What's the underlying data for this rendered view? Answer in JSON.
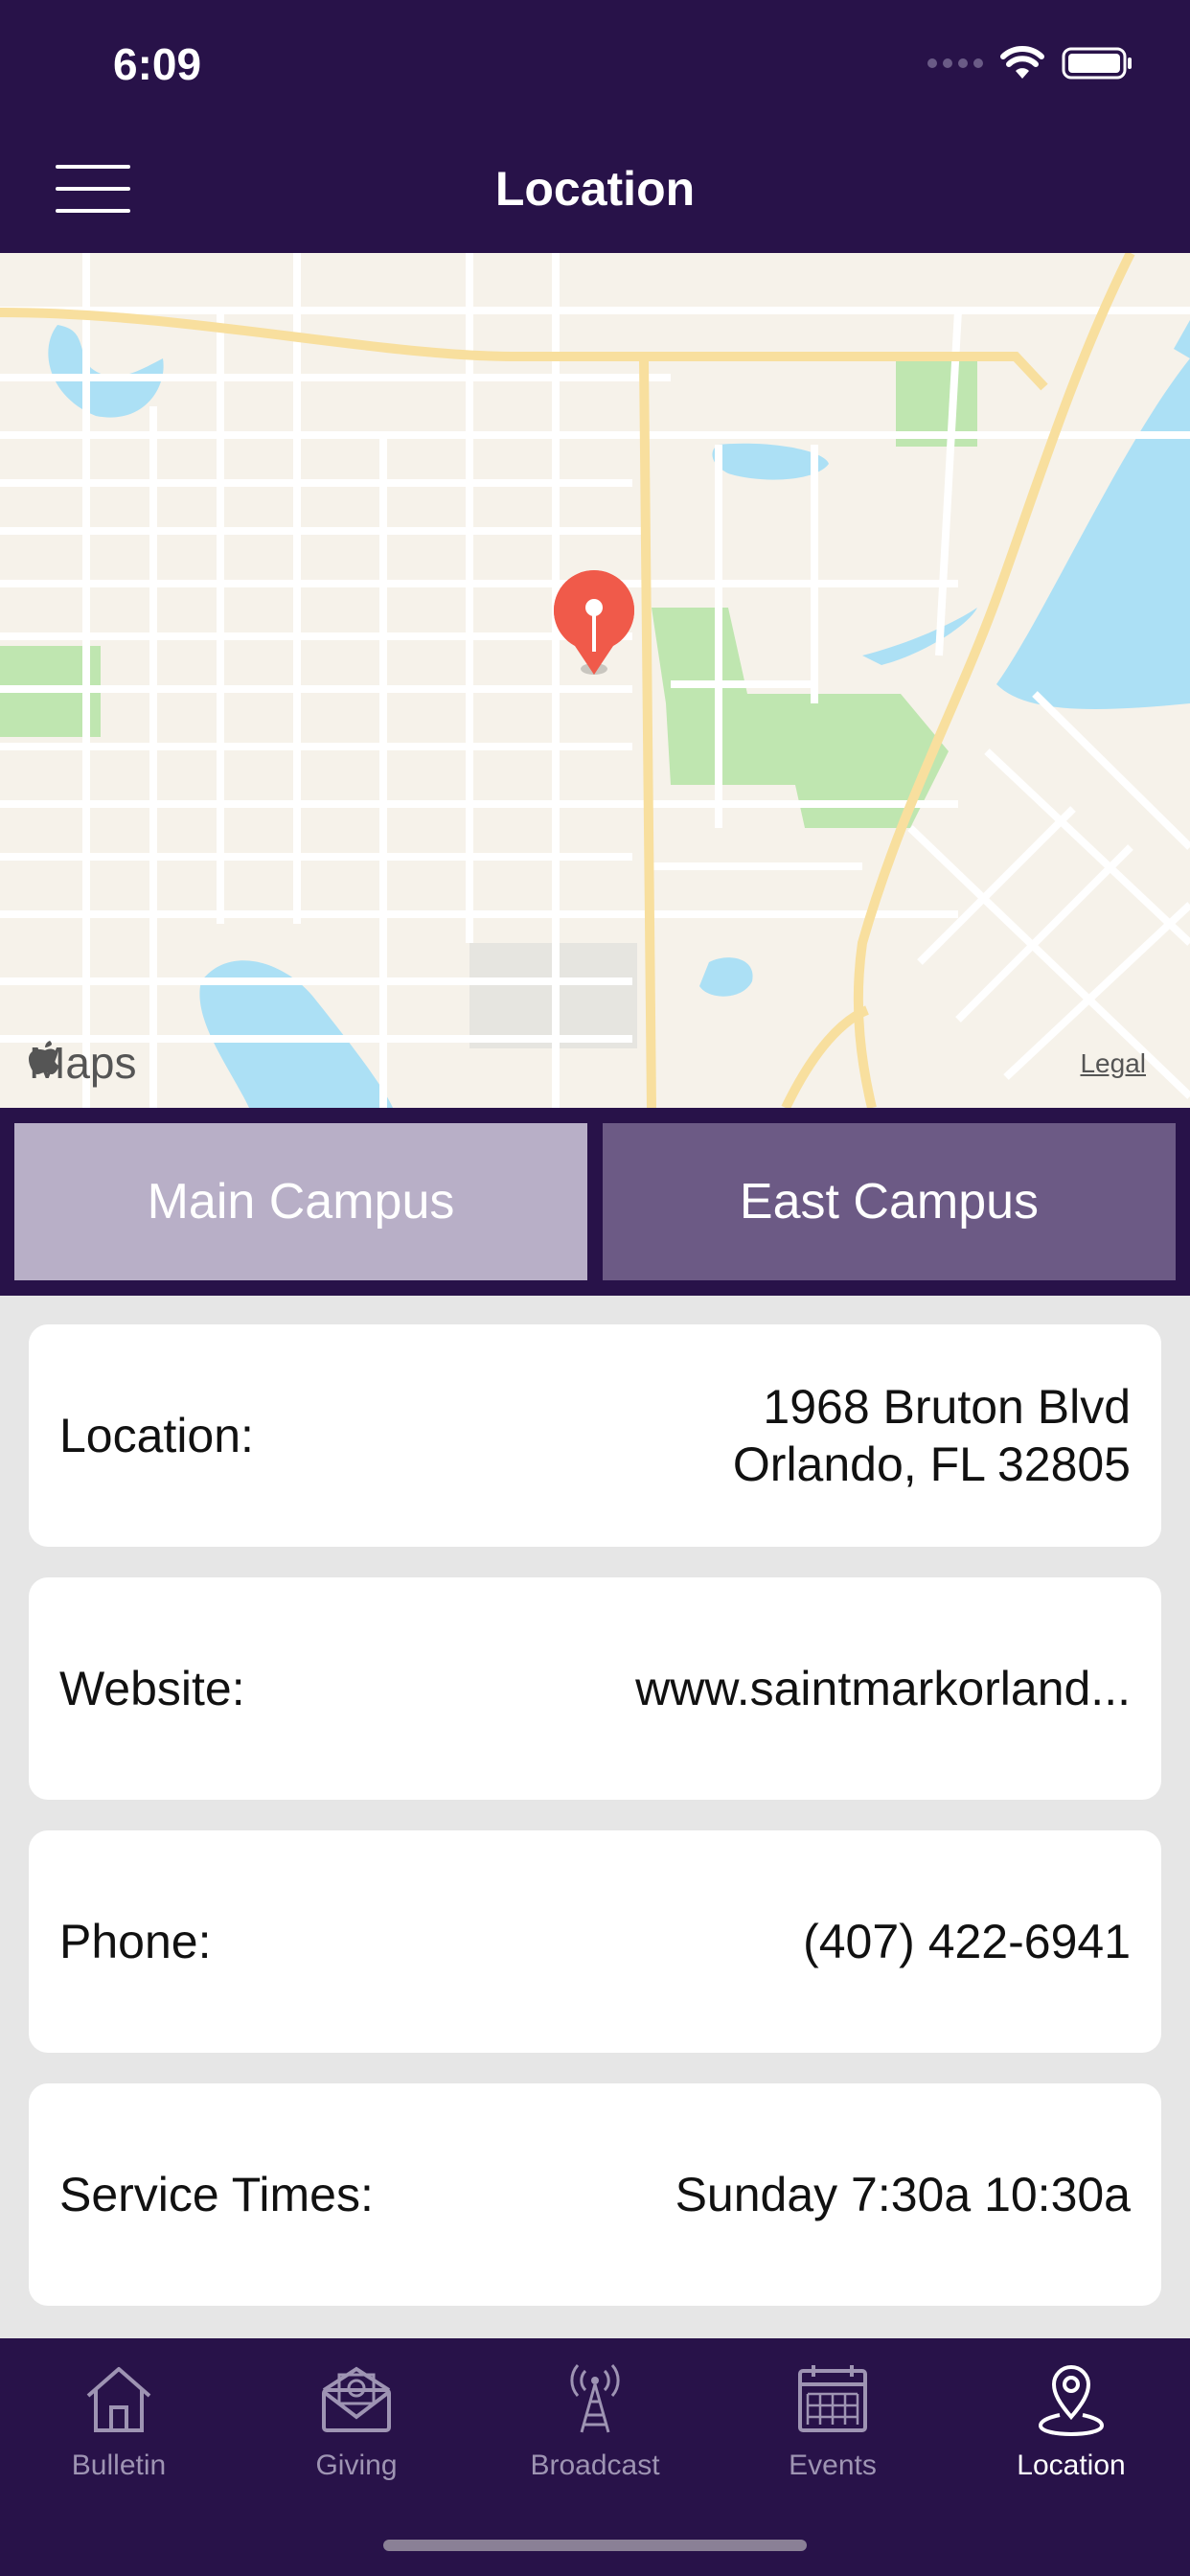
{
  "status_bar": {
    "time": "6:09"
  },
  "header": {
    "title": "Location"
  },
  "map": {
    "attribution": "Maps",
    "legal": "Legal"
  },
  "campus_tabs": [
    {
      "label": "Main Campus",
      "selected": true
    },
    {
      "label": "East Campus",
      "selected": false
    }
  ],
  "info": {
    "location": {
      "label": "Location:",
      "line1": "1968 Bruton Blvd",
      "line2": "Orlando, FL 32805"
    },
    "website": {
      "label": "Website:",
      "value": "www.saintmarkorland..."
    },
    "phone": {
      "label": "Phone:",
      "value": "(407) 422-6941"
    },
    "service_times": {
      "label": "Service Times:",
      "value": "Sunday 7:30a 10:30a"
    }
  },
  "tab_bar": {
    "items": [
      {
        "label": "Bulletin",
        "icon": "house-icon",
        "active": false
      },
      {
        "label": "Giving",
        "icon": "envelope-icon",
        "active": false
      },
      {
        "label": "Broadcast",
        "icon": "antenna-icon",
        "active": false
      },
      {
        "label": "Events",
        "icon": "calendar-icon",
        "active": false
      },
      {
        "label": "Location",
        "icon": "map-pin-icon",
        "active": true
      }
    ]
  },
  "colors": {
    "brand": "#281249",
    "segment_selected": "#b8afc7",
    "segment_unselected": "#6c5a85",
    "pin": "#f05a4a"
  }
}
